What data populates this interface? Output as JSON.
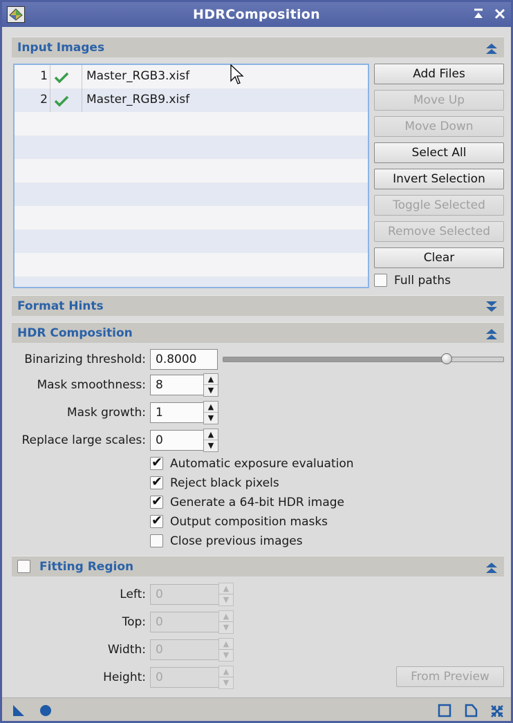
{
  "window": {
    "title": "HDRComposition",
    "accent": "#4f61a3"
  },
  "input_images": {
    "header": "Input Images",
    "rows": [
      {
        "index": "1",
        "enabled": true,
        "file": "Master_RGB3.xisf"
      },
      {
        "index": "2",
        "enabled": true,
        "file": "Master_RGB9.xisf"
      }
    ],
    "buttons": {
      "add_files": "Add Files",
      "move_up": "Move Up",
      "move_down": "Move Down",
      "select_all": "Select All",
      "invert_selection": "Invert Selection",
      "toggle_selected": "Toggle Selected",
      "remove_selected": "Remove Selected",
      "clear": "Clear"
    },
    "full_paths_label": "Full paths",
    "full_paths_checked": false
  },
  "format_hints": {
    "header": "Format Hints"
  },
  "hdr_composition": {
    "header": "HDR Composition",
    "binarizing_threshold_label": "Binarizing threshold:",
    "binarizing_threshold_value": "0.8000",
    "binarizing_threshold_fraction": 0.8,
    "mask_smoothness_label": "Mask smoothness:",
    "mask_smoothness_value": "8",
    "mask_growth_label": "Mask growth:",
    "mask_growth_value": "1",
    "replace_large_scales_label": "Replace large scales:",
    "replace_large_scales_value": "0",
    "options": [
      {
        "label": "Automatic exposure evaluation",
        "checked": true
      },
      {
        "label": "Reject black pixels",
        "checked": true
      },
      {
        "label": "Generate a 64-bit HDR image",
        "checked": true
      },
      {
        "label": "Output composition masks",
        "checked": true
      },
      {
        "label": "Close previous images",
        "checked": false
      }
    ]
  },
  "fitting_region": {
    "header": "Fitting Region",
    "enabled": false,
    "left_label": "Left:",
    "left_value": "0",
    "top_label": "Top:",
    "top_value": "0",
    "width_label": "Width:",
    "width_value": "0",
    "height_label": "Height:",
    "height_value": "0",
    "from_preview": "From Preview"
  },
  "icons": {
    "close": "close-icon",
    "shade": "shade-icon",
    "new_instance": "new-instance-triangle-icon",
    "apply_global": "apply-global-circle-icon",
    "browse_doc": "documentation-icon",
    "reset": "reset-icon",
    "preferences": "expand-icon"
  }
}
